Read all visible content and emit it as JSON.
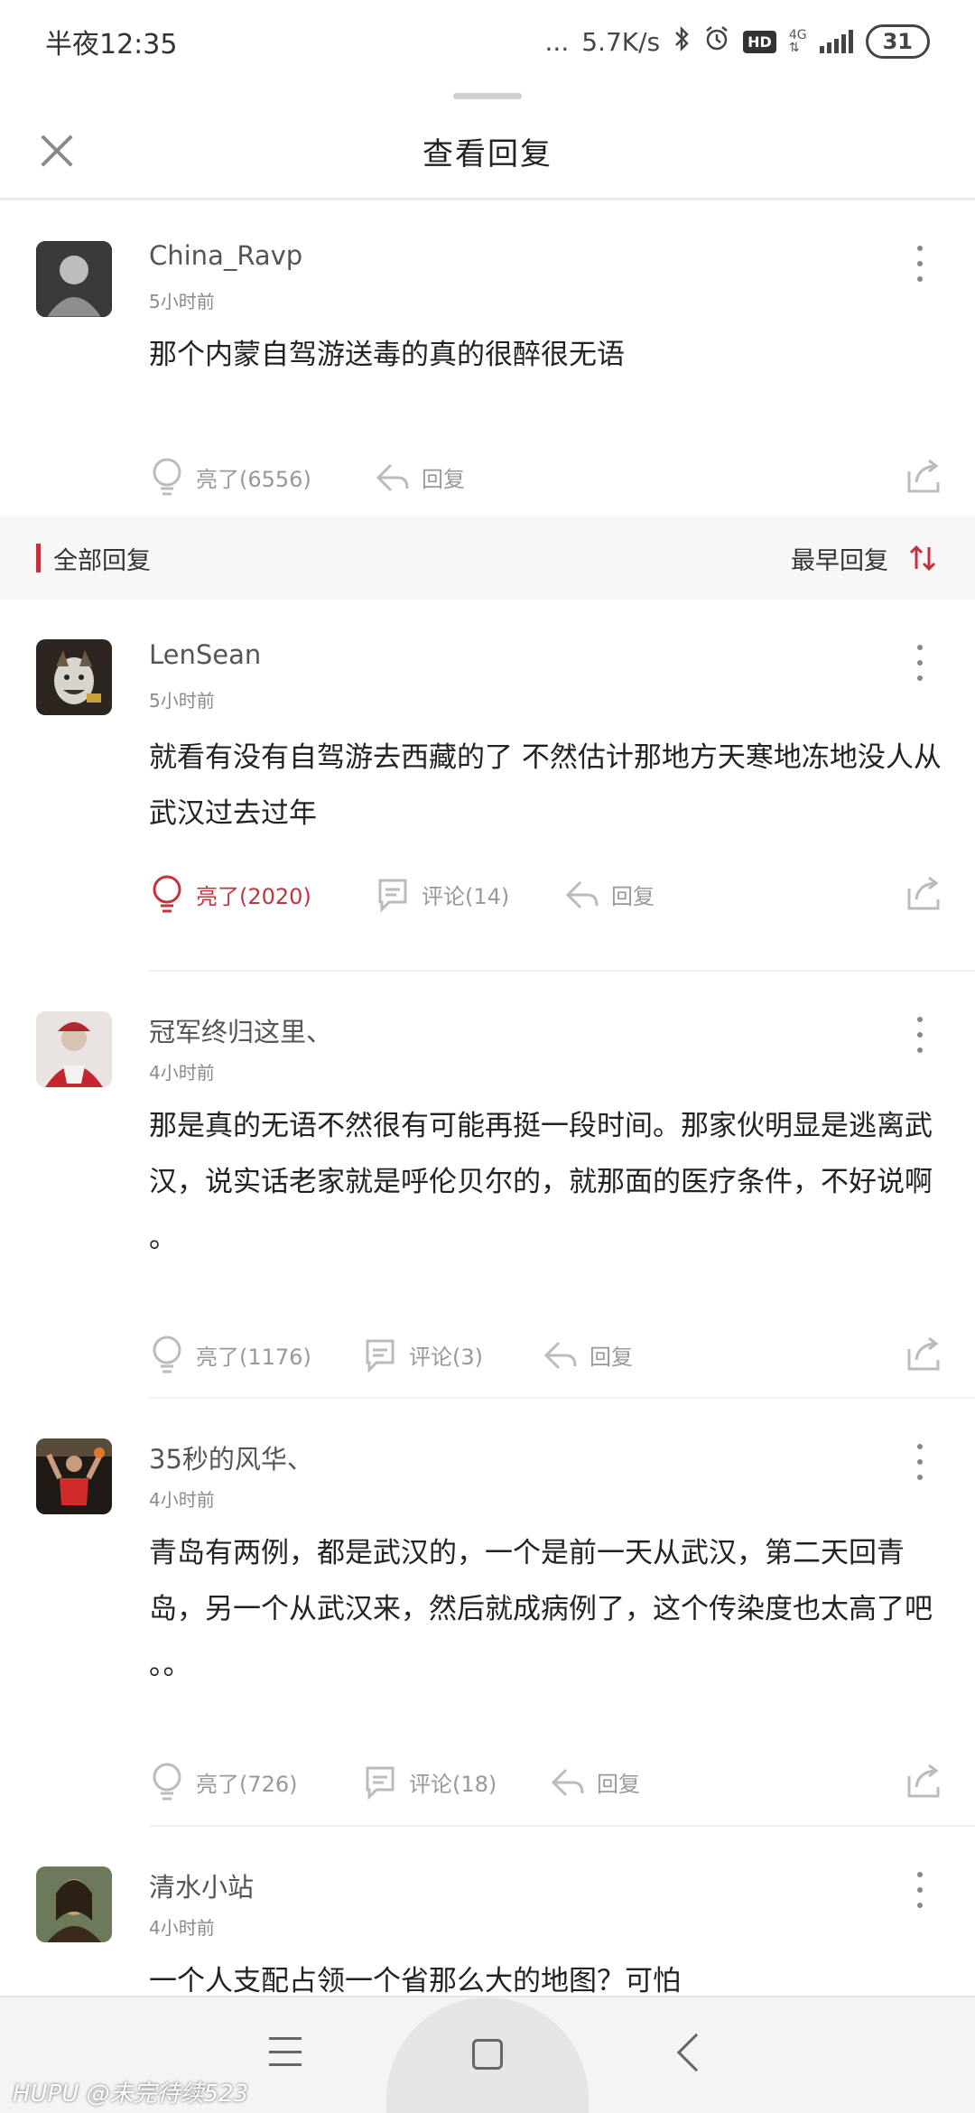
{
  "status": {
    "time": "半夜12:35",
    "dots": "...",
    "speed": "5.7K/s",
    "hd": "HD",
    "network": "4G",
    "battery": "31"
  },
  "header": {
    "title": "查看回复"
  },
  "original": {
    "user": "China_Ravp",
    "time": "5小时前",
    "text": "那个内蒙自驾游送毒的真的很醉很无语",
    "light_label": "亮了(6556)",
    "reply_label": "回复"
  },
  "section": {
    "title": "全部回复",
    "sort_label": "最早回复"
  },
  "replies": [
    {
      "user": "LenSean",
      "time": "5小时前",
      "text": "就看有没有自驾游去西藏的了 不然估计那地方天寒地冻地没人从武汉过去过年",
      "light_label": "亮了(2020)",
      "comment_label": "评论(14)",
      "reply_label": "回复"
    },
    {
      "user": "冠军终归这里、",
      "time": "4小时前",
      "text": "那是真的无语不然很有可能再挺一段时间。那家伙明显是逃离武汉，说实话老家就是呼伦贝尔的，就那面的医疗条件，不好说啊 。",
      "light_label": "亮了(1176)",
      "comment_label": "评论(3)",
      "reply_label": "回复"
    },
    {
      "user": "35秒的风华、",
      "time": "4小时前",
      "text": "青岛有两例，都是武汉的，一个是前一天从武汉，第二天回青岛，另一个从武汉来，然后就成病例了，这个传染度也太高了吧 。。",
      "light_label": "亮了(726)",
      "comment_label": "评论(18)",
      "reply_label": "回复"
    },
    {
      "user": "清水小站",
      "time": "4小时前",
      "text": "一个人支配占领一个省那么大的地图？可怕"
    }
  ],
  "watermark": "HUPU @未完待续523",
  "colors": {
    "accent": "#c0343e",
    "muted": "#999999"
  }
}
